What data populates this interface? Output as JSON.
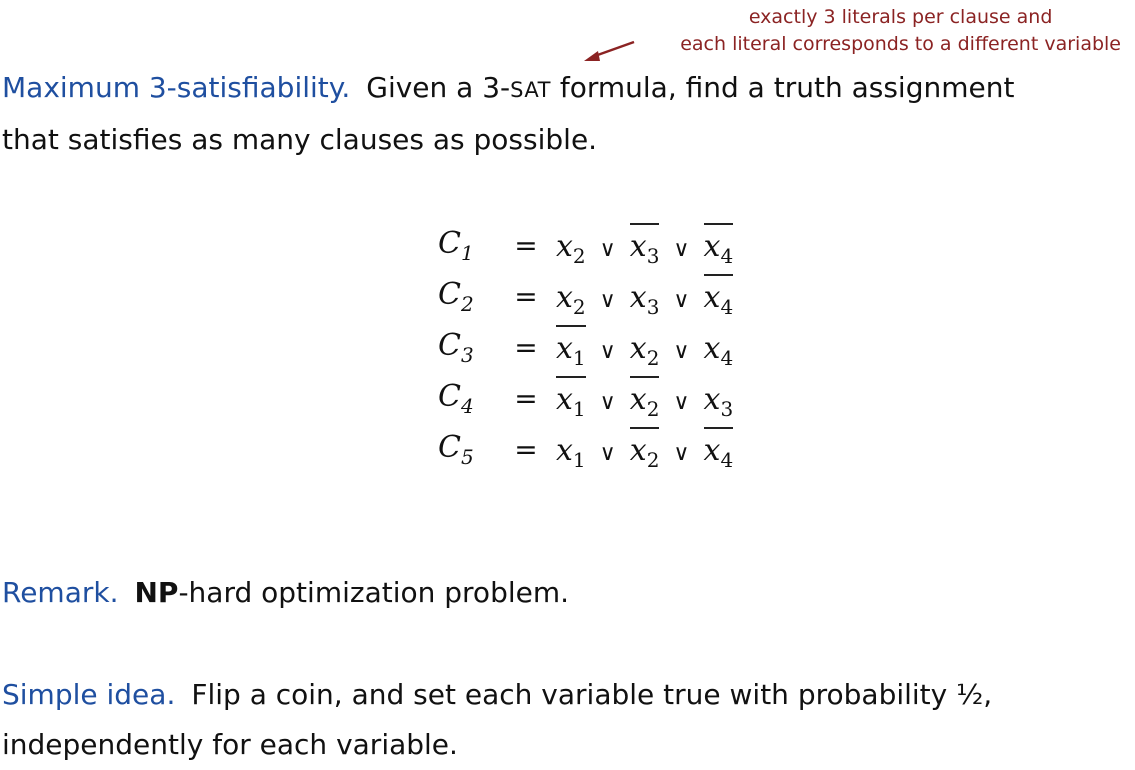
{
  "annotation": {
    "line1": "exactly 3 literals per clause and",
    "line2": "each literal corresponds to a different variable"
  },
  "definition": {
    "keyword": "Maximum 3-satisfiability.",
    "text_before": "Given a 3-",
    "text_smallcaps": "SAT",
    "text_after": " formula, find a truth assignment",
    "line2": "that satisfies as many clauses as possible."
  },
  "clauses": [
    {
      "name": "C",
      "index": "1",
      "literals": [
        {
          "var": "x",
          "sub": "2",
          "negated": false
        },
        {
          "var": "x",
          "sub": "3",
          "negated": true
        },
        {
          "var": "x",
          "sub": "4",
          "negated": true
        }
      ]
    },
    {
      "name": "C",
      "index": "2",
      "literals": [
        {
          "var": "x",
          "sub": "2",
          "negated": false
        },
        {
          "var": "x",
          "sub": "3",
          "negated": false
        },
        {
          "var": "x",
          "sub": "4",
          "negated": true
        }
      ]
    },
    {
      "name": "C",
      "index": "3",
      "literals": [
        {
          "var": "x",
          "sub": "1",
          "negated": true
        },
        {
          "var": "x",
          "sub": "2",
          "negated": false
        },
        {
          "var": "x",
          "sub": "4",
          "negated": false
        }
      ]
    },
    {
      "name": "C",
      "index": "4",
      "literals": [
        {
          "var": "x",
          "sub": "1",
          "negated": true
        },
        {
          "var": "x",
          "sub": "2",
          "negated": true
        },
        {
          "var": "x",
          "sub": "3",
          "negated": false
        }
      ]
    },
    {
      "name": "C",
      "index": "5",
      "literals": [
        {
          "var": "x",
          "sub": "1",
          "negated": false
        },
        {
          "var": "x",
          "sub": "2",
          "negated": true
        },
        {
          "var": "x",
          "sub": "4",
          "negated": true
        }
      ]
    }
  ],
  "symbols": {
    "equals": "=",
    "or": "∨"
  },
  "remark": {
    "keyword": "Remark.",
    "bold": "NP",
    "text": "-hard optimization problem."
  },
  "idea": {
    "keyword": "Simple idea.",
    "text": "Flip a coin, and set each variable true with probability ½,",
    "line2": "independently for each variable."
  },
  "colors": {
    "keyword": "#1f4fa0",
    "annotation": "#8b2323",
    "text": "#111111"
  }
}
